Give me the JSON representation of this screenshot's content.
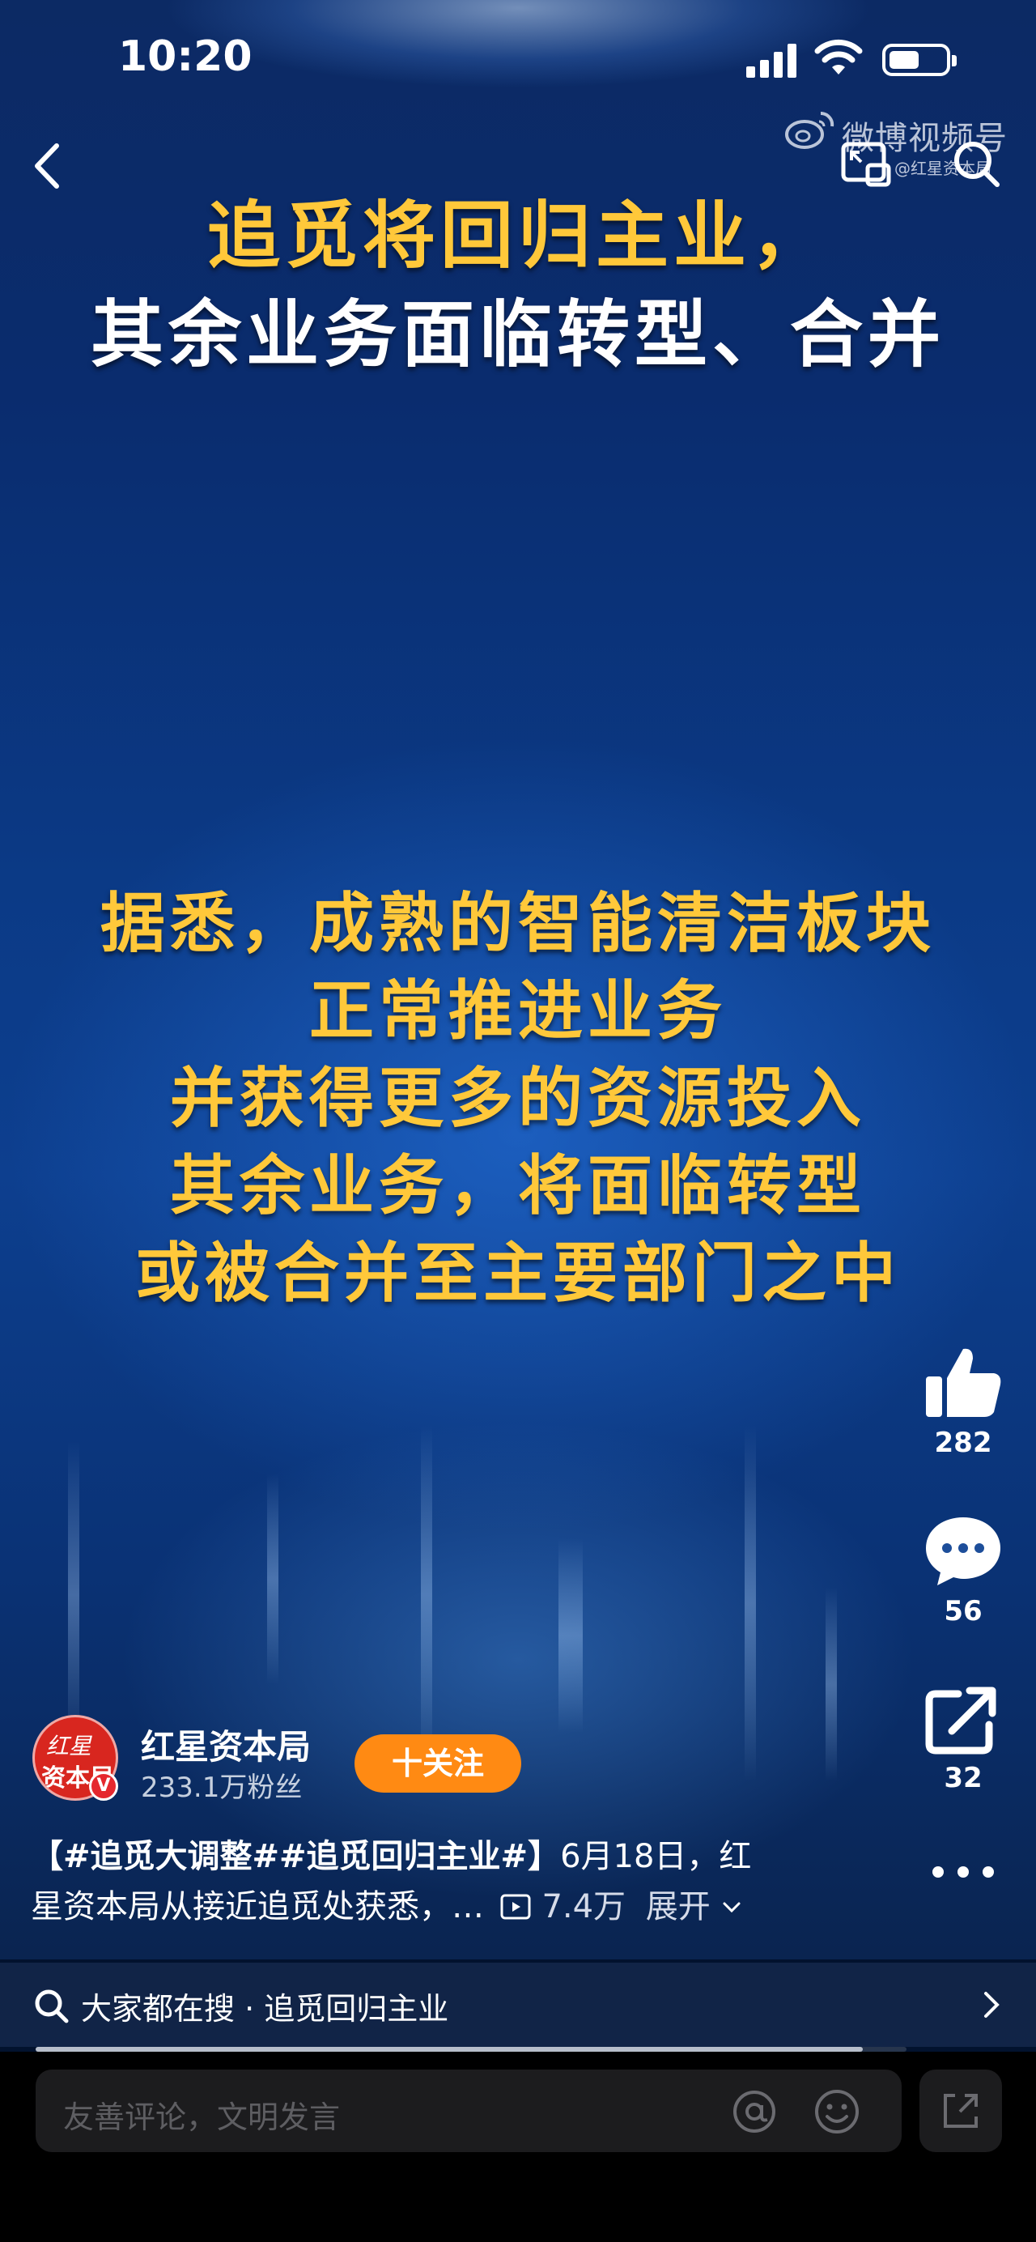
{
  "status_bar": {
    "time": "10:20"
  },
  "watermark": {
    "platform": "微博视频号",
    "account": "@红星资本局"
  },
  "video": {
    "headline_line1": "追觅将回归主业，",
    "headline_line2": "其余业务面临转型、合并",
    "body_lines": [
      "据悉，成熟的智能清洁板块",
      "正常推进业务",
      "并获得更多的资源投入",
      "其余业务，将面临转型",
      "或被合并至主要部门之中"
    ]
  },
  "actions": {
    "likes": "282",
    "comments": "56",
    "shares": "32"
  },
  "author": {
    "avatar_line1": "红星",
    "avatar_line2": "资本局",
    "verified_mark": "V",
    "name": "红星资本局",
    "fans": "233.1万粉丝",
    "follow_label": "十关注"
  },
  "description": {
    "tags": "【#追觅大调整##追觅回归主业#】",
    "text_line1": "6月18日，红",
    "text_line2": "星资本局从接近追觅处获悉，…",
    "views": "7.4万",
    "expand_label": "展开"
  },
  "search_strip": {
    "label": "大家都在搜 · 追觅回归主业"
  },
  "playback": {
    "progress": 0.95
  },
  "comment_input": {
    "placeholder": "友善评论，文明发言"
  },
  "colors": {
    "headline_yellow": "#ffc83a",
    "follow_orange": "#ff8a13",
    "badge_red": "#e5282e"
  }
}
